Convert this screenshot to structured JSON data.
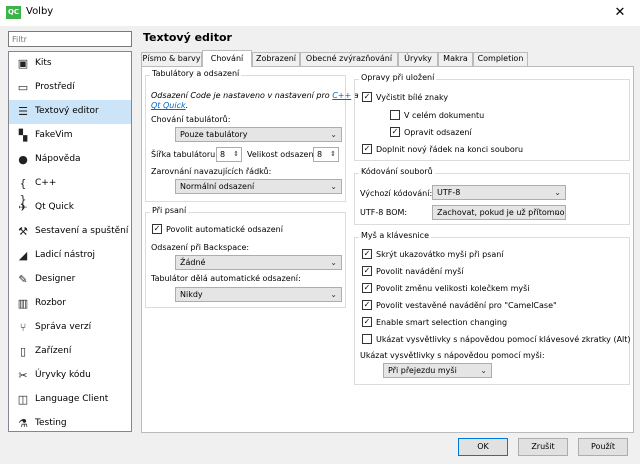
{
  "window": {
    "title": "Volby",
    "icon": "QC"
  },
  "filter": {
    "placeholder": "Filtr",
    "value": ""
  },
  "sidebar": {
    "items": [
      {
        "label": "Kits",
        "icon": "monitor-icon",
        "glyph": "▣"
      },
      {
        "label": "Prostředí",
        "icon": "desktop-icon",
        "glyph": "▭"
      },
      {
        "label": "Textový editor",
        "icon": "text-editor-icon",
        "glyph": "☰",
        "selected": true
      },
      {
        "label": "FakeVim",
        "icon": "fakevim-icon",
        "glyph": "▚"
      },
      {
        "label": "Nápověda",
        "icon": "help-icon",
        "glyph": "●"
      },
      {
        "label": "C++",
        "icon": "braces-icon",
        "glyph": "{ }"
      },
      {
        "label": "Qt Quick",
        "icon": "qtquick-icon",
        "glyph": "✈"
      },
      {
        "label": "Sestavení a spuštění",
        "icon": "hammer-icon",
        "glyph": "⚒"
      },
      {
        "label": "Ladicí nástroj",
        "icon": "debugger-icon",
        "glyph": "◢"
      },
      {
        "label": "Designer",
        "icon": "designer-icon",
        "glyph": "✎"
      },
      {
        "label": "Rozbor",
        "icon": "analyzer-icon",
        "glyph": "▥"
      },
      {
        "label": "Správa verzí",
        "icon": "version-control-icon",
        "glyph": "⑂"
      },
      {
        "label": "Zařízení",
        "icon": "device-icon",
        "glyph": "▯"
      },
      {
        "label": "Úryvky kódu",
        "icon": "snippets-icon",
        "glyph": "✂"
      },
      {
        "label": "Language Client",
        "icon": "language-client-icon",
        "glyph": "◫"
      },
      {
        "label": "Testing",
        "icon": "testing-icon",
        "glyph": "⚗"
      }
    ]
  },
  "page": {
    "title": "Textový editor"
  },
  "tabs": [
    {
      "label": "Písmo & barvy"
    },
    {
      "label": "Chování",
      "active": true
    },
    {
      "label": "Zobrazení"
    },
    {
      "label": "Obecné zvýrazňování"
    },
    {
      "label": "Úryvky"
    },
    {
      "label": "Makra"
    },
    {
      "label": "Completion"
    }
  ],
  "tabs_group": {
    "title": "Tabulátory a odsazení",
    "note_prefix": "Odsazení Code je nastaveno v nastavení pro",
    "note_link1": "C++",
    "note_mid": "a",
    "note_link2": "Qt Quick",
    "note_suffix": ".",
    "tab_policy_label": "Chování tabulátorů:",
    "tab_policy_value": "Pouze tabulátory",
    "tab_size_label": "Šířka tabulátoru:",
    "tab_size_value": "8",
    "indent_size_label": "Velikost odsazení:",
    "indent_size_value": "8",
    "align_label": "Zarovnání navazujících řádků:",
    "align_value": "Normální odsazení"
  },
  "typing_group": {
    "title": "Při psaní",
    "auto_indent_label": "Povolit automatické odsazení",
    "auto_indent_checked": true,
    "backspace_label": "Odsazení při Backspace:",
    "backspace_value": "Žádné",
    "tab_auto_label": "Tabulátor dělá automatické odsazení:",
    "tab_auto_value": "Nikdy"
  },
  "cleanup_group": {
    "title": "Opravy při uložení",
    "items": [
      {
        "label": "Vyčistit bílé znaky",
        "checked": true
      },
      {
        "label": "V celém dokumentu",
        "checked": false
      },
      {
        "label": "Opravit odsazení",
        "checked": true
      },
      {
        "label": "Doplnit nový řádek na konci souboru",
        "checked": true
      }
    ]
  },
  "encoding_group": {
    "title": "Kódování souborů",
    "default_label": "Výchozí kódování:",
    "default_value": "UTF-8",
    "bom_label": "UTF-8 BOM:",
    "bom_value": "Zachovat, pokud je už přítomno"
  },
  "mouse_group": {
    "title": "Myš a klávesnice",
    "items": [
      {
        "label": "Skrýt ukazovátko myši při psaní",
        "checked": true
      },
      {
        "label": "Povolit navádění myší",
        "checked": true
      },
      {
        "label": "Povolit změnu velikosti kolečkem myši",
        "checked": true
      },
      {
        "label": "Povolit vestavěné navádění pro \"CamelCase\"",
        "checked": true
      },
      {
        "label": "Enable smart selection changing",
        "checked": true
      },
      {
        "label": "Ukázat vysvětlivky s nápovědou pomocí klávesové zkratky (Alt)",
        "checked": false
      }
    ],
    "tooltip_label": "Ukázat vysvětlivky s nápovědou pomocí myši:",
    "tooltip_value": "Při přejezdu myši"
  },
  "buttons": {
    "ok": "OK",
    "cancel": "Zrušit",
    "apply": "Použít"
  }
}
